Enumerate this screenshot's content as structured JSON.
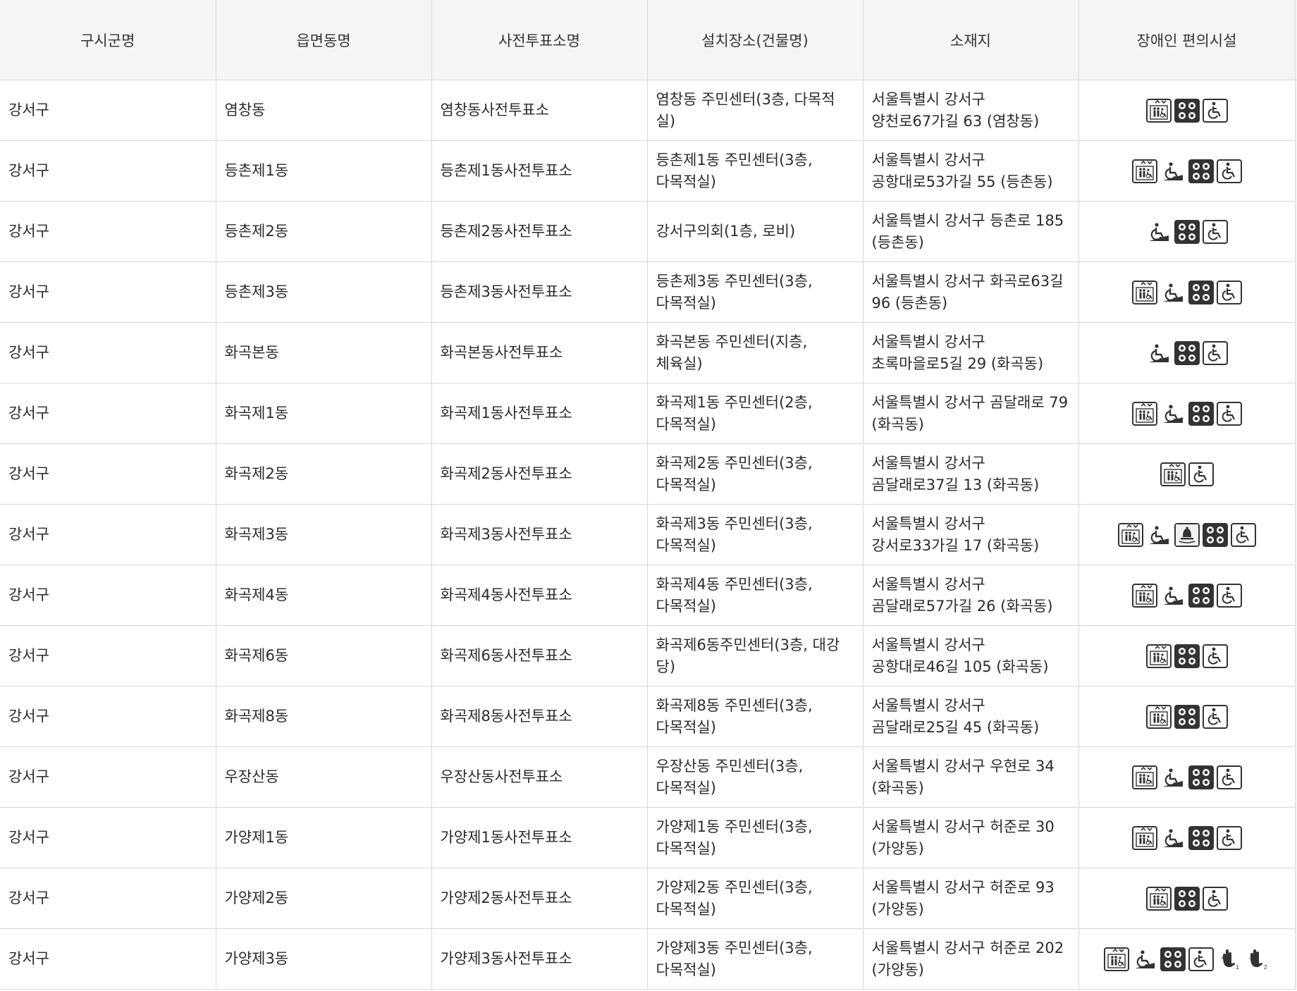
{
  "table": {
    "headers": [
      "구시군명",
      "읍면동명",
      "사전투표소명",
      "설치장소(건물명)",
      "소재지",
      "장애인 편의시설"
    ],
    "rows": [
      {
        "district": "강서구",
        "dong": "염창동",
        "station": "염창동사전투표소",
        "place": "염창동 주민센터(3층, 다목적실)",
        "address": "서울특별시 강서구\n양천로67가길 63 (염창동)",
        "facilities": [
          "elevator-icon",
          "braille-block-icon",
          "wheelchair-icon"
        ]
      },
      {
        "district": "강서구",
        "dong": "등촌제1동",
        "station": "등촌제1동사전투표소",
        "place": "등촌제1동 주민센터(3층,\n다목적실)",
        "address": "서울특별시 강서구\n공항대로53가길 55 (등촌동)",
        "facilities": [
          "elevator-icon",
          "ramp-icon",
          "braille-block-icon",
          "wheelchair-icon"
        ]
      },
      {
        "district": "강서구",
        "dong": "등촌제2동",
        "station": "등촌제2동사전투표소",
        "place": "강서구의회(1층, 로비)",
        "address": "서울특별시 강서구 등촌로 185\n(등촌동)",
        "facilities": [
          "ramp-icon",
          "braille-block-icon",
          "wheelchair-icon"
        ]
      },
      {
        "district": "강서구",
        "dong": "등촌제3동",
        "station": "등촌제3동사전투표소",
        "place": "등촌제3동 주민센터(3층,\n다목적실)",
        "address": "서울특별시 강서구 화곡로63길\n96 (등촌동)",
        "facilities": [
          "elevator-icon",
          "ramp-icon",
          "braille-block-icon",
          "wheelchair-icon"
        ]
      },
      {
        "district": "강서구",
        "dong": "화곡본동",
        "station": "화곡본동사전투표소",
        "place": "화곡본동 주민센터(지층,\n체육실)",
        "address": "서울특별시 강서구\n초록마을로5길 29 (화곡동)",
        "facilities": [
          "ramp-icon",
          "braille-block-icon",
          "wheelchair-icon"
        ]
      },
      {
        "district": "강서구",
        "dong": "화곡제1동",
        "station": "화곡제1동사전투표소",
        "place": "화곡제1동 주민센터(2층,\n다목적실)",
        "address": "서울특별시 강서구 곰달래로 79\n(화곡동)",
        "facilities": [
          "elevator-icon",
          "ramp-icon",
          "braille-block-icon",
          "wheelchair-icon"
        ]
      },
      {
        "district": "강서구",
        "dong": "화곡제2동",
        "station": "화곡제2동사전투표소",
        "place": "화곡제2동 주민센터(3층,\n다목적실)",
        "address": "서울특별시 강서구\n곰달래로37길 13 (화곡동)",
        "facilities": [
          "elevator-icon",
          "wheelchair-icon"
        ]
      },
      {
        "district": "강서구",
        "dong": "화곡제3동",
        "station": "화곡제3동사전투표소",
        "place": "화곡제3동 주민센터(3층,\n다목적실)",
        "address": "서울특별시 강서구\n강서로33가길 17 (화곡동)",
        "facilities": [
          "elevator-icon",
          "ramp-icon",
          "call-bell-icon",
          "braille-block-icon",
          "wheelchair-icon"
        ]
      },
      {
        "district": "강서구",
        "dong": "화곡제4동",
        "station": "화곡제4동사전투표소",
        "place": "화곡제4동 주민센터(3층,\n다목적실)",
        "address": "서울특별시 강서구\n곰달래로57가길 26 (화곡동)",
        "facilities": [
          "elevator-icon",
          "ramp-icon",
          "braille-block-icon",
          "wheelchair-icon"
        ]
      },
      {
        "district": "강서구",
        "dong": "화곡제6동",
        "station": "화곡제6동사전투표소",
        "place": "화곡제6동주민센터(3층, 대강당)",
        "address": "서울특별시 강서구\n공항대로46길 105 (화곡동)",
        "facilities": [
          "elevator-icon",
          "braille-block-icon",
          "wheelchair-icon"
        ]
      },
      {
        "district": "강서구",
        "dong": "화곡제8동",
        "station": "화곡제8동사전투표소",
        "place": "화곡제8동 주민센터(3층,\n다목적실)",
        "address": "서울특별시 강서구\n곰달래로25길 45 (화곡동)",
        "facilities": [
          "elevator-icon",
          "braille-block-icon",
          "wheelchair-icon"
        ]
      },
      {
        "district": "강서구",
        "dong": "우장산동",
        "station": "우장산동사전투표소",
        "place": "우장산동 주민센터(3층,\n다목적실)",
        "address": "서울특별시 강서구 우현로 34\n(화곡동)",
        "facilities": [
          "elevator-icon",
          "ramp-icon",
          "braille-block-icon",
          "wheelchair-icon"
        ]
      },
      {
        "district": "강서구",
        "dong": "가양제1동",
        "station": "가양제1동사전투표소",
        "place": "가양제1동 주민센터(3층,\n다목적실)",
        "address": "서울특별시 강서구 허준로 30\n(가양동)",
        "facilities": [
          "elevator-icon",
          "ramp-icon",
          "braille-block-icon",
          "wheelchair-icon"
        ]
      },
      {
        "district": "강서구",
        "dong": "가양제2동",
        "station": "가양제2동사전투표소",
        "place": "가양제2동 주민센터(3층,\n다목적실)",
        "address": "서울특별시 강서구 허준로 93\n(가양동)",
        "facilities": [
          "elevator-icon",
          "braille-block-icon",
          "wheelchair-icon"
        ]
      },
      {
        "district": "강서구",
        "dong": "가양제3동",
        "station": "가양제3동사전투표소",
        "place": "가양제3동 주민센터(3층,\n다목적실)",
        "address": "서울특별시 강서구 허준로 202\n(가양동)",
        "facilities": [
          "elevator-icon",
          "ramp-icon",
          "braille-block-icon",
          "wheelchair-icon",
          "sign-language-1-icon",
          "sign-language-2-icon"
        ]
      }
    ]
  }
}
